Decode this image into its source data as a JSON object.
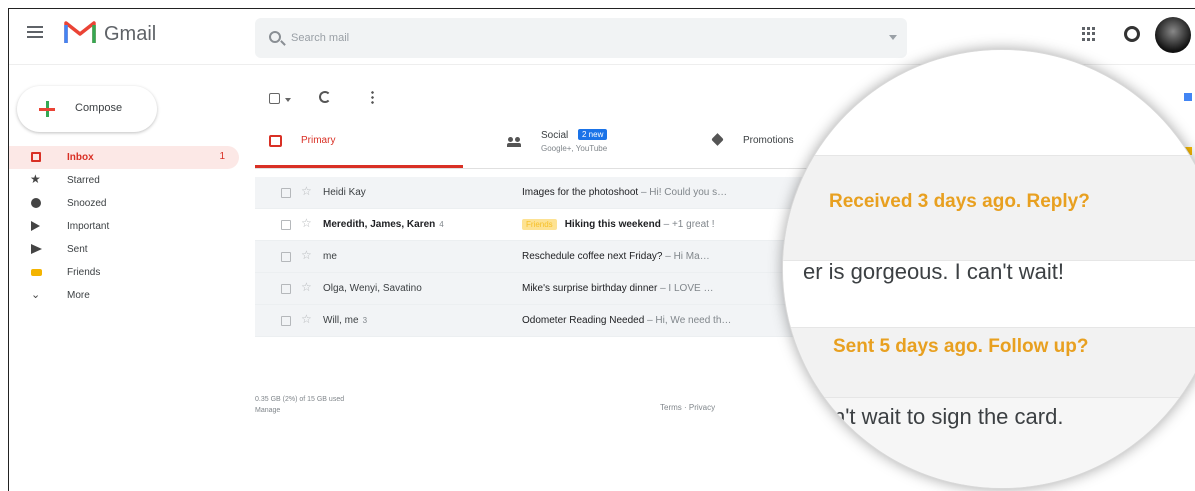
{
  "header": {
    "app_name": "Gmail",
    "search_placeholder": "Search mail",
    "brand_colors": {
      "red": "#EA4335",
      "blue": "#4285F4",
      "green": "#34A853",
      "yellow": "#FBBC04"
    }
  },
  "sidebar": {
    "compose_label": "Compose",
    "items": [
      {
        "label": "Inbox",
        "icon": "inbox-icon",
        "count": "1",
        "active": true
      },
      {
        "label": "Starred",
        "icon": "star-icon"
      },
      {
        "label": "Snoozed",
        "icon": "clock-icon"
      },
      {
        "label": "Important",
        "icon": "important-icon"
      },
      {
        "label": "Sent",
        "icon": "send-icon"
      },
      {
        "label": "Friends",
        "icon": "label-icon"
      },
      {
        "label": "More",
        "icon": "chevron-down-icon"
      }
    ]
  },
  "tabs": {
    "primary": "Primary",
    "social": "Social",
    "social_badge": "2 new",
    "social_sub": "Google+, YouTube",
    "promotions": "Promotions"
  },
  "emails": [
    {
      "sender": "Heidi Kay",
      "count": "",
      "label": "",
      "subject": "Images for the photoshoot",
      "snippet": " – Hi! Could you s…",
      "unread": false
    },
    {
      "sender": "Meredith, James, Karen",
      "count": "4",
      "label": "Friends",
      "subject": "Hiking this weekend",
      "snippet": " – +1 great !",
      "unread": true
    },
    {
      "sender": "me",
      "count": "",
      "label": "",
      "subject": "Reschedule coffee next Friday?",
      "snippet": " – Hi Ma…",
      "unread": false
    },
    {
      "sender": "Olga, Wenyi, Savatino",
      "count": "",
      "label": "",
      "subject": "Mike's surprise birthday dinner",
      "snippet": " – I LOVE …",
      "unread": false
    },
    {
      "sender": "Will, me",
      "count": "3",
      "label": "",
      "subject": "Odometer Reading Needed",
      "snippet": " – Hi, We need th…",
      "unread": false
    }
  ],
  "footer": {
    "storage": "0.35 GB (2%) of 15 GB used",
    "manage": "Manage",
    "links": "Terms · Privacy"
  },
  "magnifier": {
    "nudge_1": "Received 3 days ago. Reply?",
    "snippet_1": "er is gorgeous.  I can't wait!",
    "nudge_2": "Sent 5 days ago. Follow up?",
    "snippet_2": "n't wait to sign the card."
  }
}
